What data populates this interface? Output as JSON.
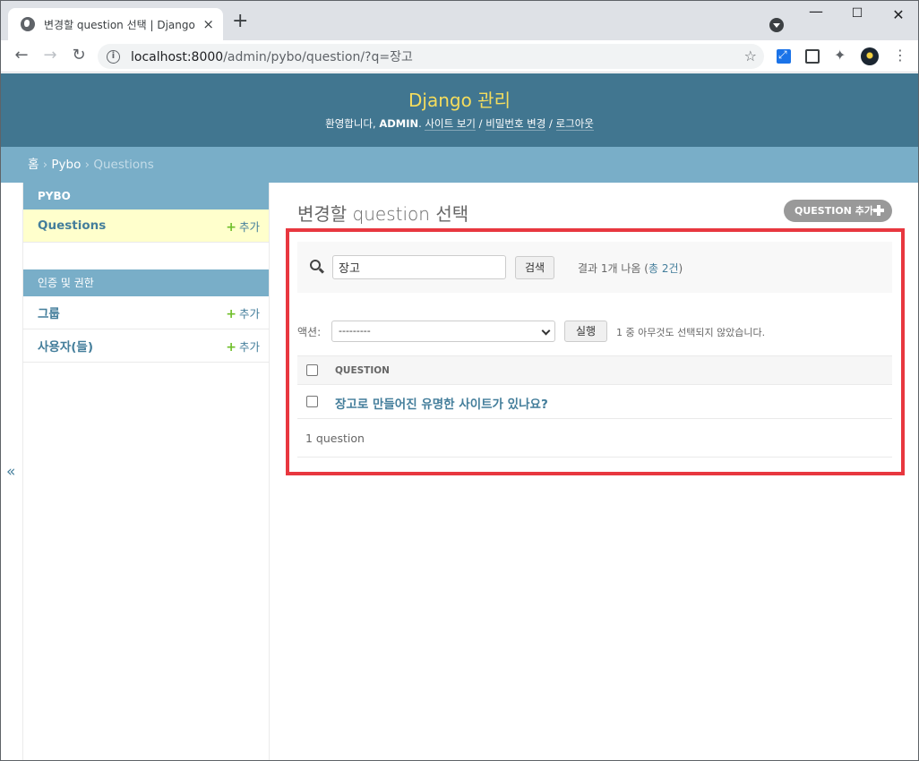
{
  "browser": {
    "tab_title": "변경할 question 선택 | Django",
    "tab_close": "×",
    "new_tab": "+",
    "url_host": "localhost:8000",
    "url_path": "/admin/pybo/question/?q=장고",
    "win_min": "—",
    "win_max": "☐",
    "win_close": "✕"
  },
  "header": {
    "site_name": "Django 관리",
    "welcome": "환영합니다, ",
    "username": "ADMIN",
    "view_site": "사이트 보기",
    "change_password": "비밀번호 변경",
    "logout": "로그아웃",
    "sep": " / "
  },
  "breadcrumbs": {
    "home": "홈",
    "app": "Pybo",
    "current": "Questions",
    "sep": " › "
  },
  "sidebar": {
    "collapse": "«",
    "apps": [
      {
        "caption": "PYBO",
        "models": [
          {
            "name": "Questions",
            "add": "추가"
          }
        ]
      },
      {
        "caption": "인증 및 권한",
        "models": [
          {
            "name": "그룹",
            "add": "추가"
          },
          {
            "name": "사용자(들)",
            "add": "추가"
          }
        ]
      }
    ]
  },
  "main": {
    "title": "변경할 question 선택",
    "add_button": "QUESTION 추가",
    "search_value": "장고",
    "search_button": "검색",
    "search_result_prefix": "결과 1개 나옴 (",
    "search_result_total": "총 2건",
    "search_result_suffix": ")",
    "action_label": "액션:",
    "action_selected": "---------",
    "go_button": "실행",
    "action_counter": "1 중 아무것도 선택되지 않았습니다.",
    "column_header": "QUESTION",
    "rows": [
      "장고로 만들어진 유명한 사이트가 있나요?"
    ],
    "paginator": "1 question"
  },
  "colors": {
    "header_bg": "#417690",
    "branding": "#f5dd5d",
    "breadcrumb_bg": "#79aec8",
    "link": "#447e9b",
    "highlight": "#e8373f",
    "current_model_bg": "#ffffcc",
    "add_plus": "#70bf2b"
  }
}
